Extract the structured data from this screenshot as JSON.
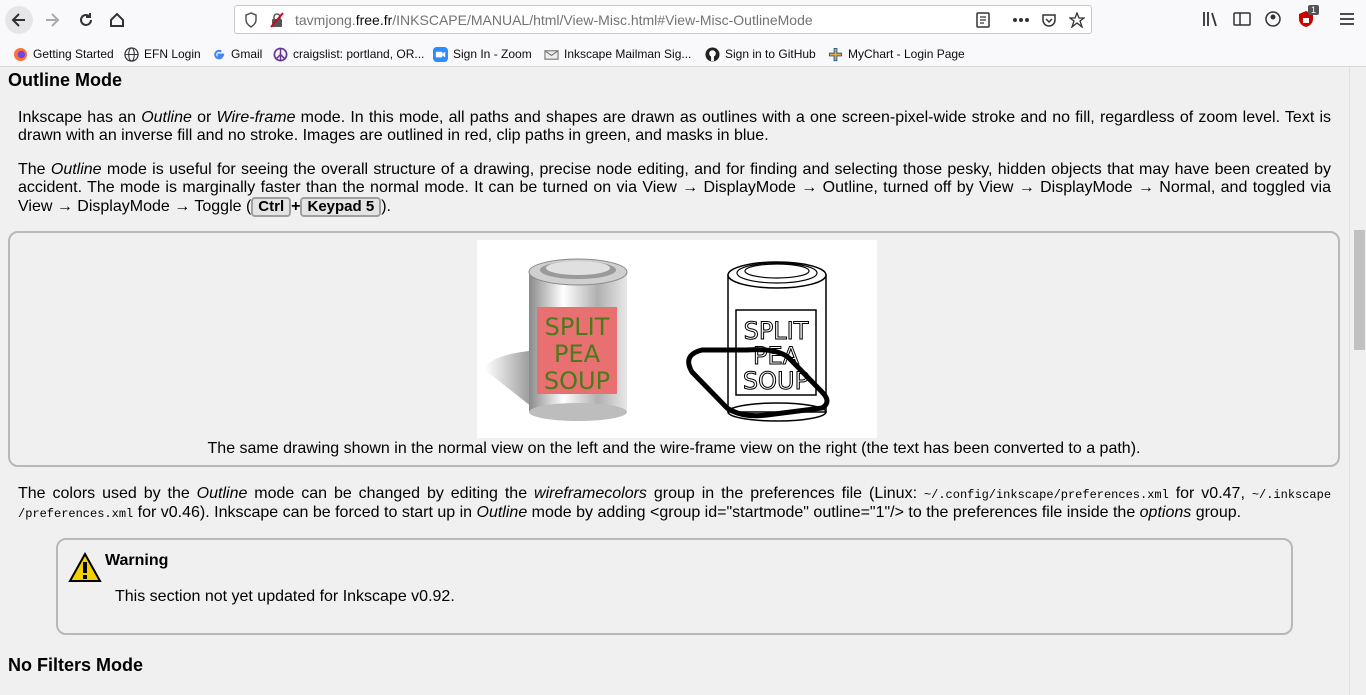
{
  "browser": {
    "url_prefix": "tavmjong.",
    "url_host": "free.fr",
    "url_path": "/INKSCAPE/MANUAL/html/View-Misc.html#View-Misc-OutlineMode",
    "notification_count": "1"
  },
  "bookmarks": [
    {
      "label": "Getting Started",
      "icon": "firefox-icon"
    },
    {
      "label": "EFN Login",
      "icon": "globe-icon"
    },
    {
      "label": "Gmail",
      "icon": "google-icon"
    },
    {
      "label": "craigslist: portland, OR...",
      "icon": "peace-icon"
    },
    {
      "label": "Sign In - Zoom",
      "icon": "zoom-icon"
    },
    {
      "label": "Inkscape Mailman Sig...",
      "icon": "mailman-icon"
    },
    {
      "label": "Sign in to GitHub",
      "icon": "github-icon"
    },
    {
      "label": "MyChart - Login Page",
      "icon": "cross-icon"
    }
  ],
  "page": {
    "heading1": "Outline Mode",
    "p1": {
      "a": "Inkscape has an ",
      "outline": "Outline",
      "b": " or ",
      "wireframe": "Wire-frame",
      "c": " mode. In this mode, all paths and shapes are drawn as outlines with a one screen-pixel-wide stroke and no fill, regardless of zoom level. Text is drawn with an inverse fill and no stroke. Images are outlined in red, clip paths in green, and masks in blue."
    },
    "p2": {
      "a": "The ",
      "outline": "Outline",
      "b": " mode is useful for seeing the overall structure of a drawing, precise node editing, and for finding and selecting those pesky, hidden objects that may have been created by accident. The mode is marginally faster than the normal mode. It can be turned on via View → DisplayMode → Outline, turned off by View → DisplayMode → Normal, and toggled via View → DisplayMode → Toggle (",
      "key1": "Ctrl",
      "plus": "+",
      "key2": "Keypad 5",
      "c": ")."
    },
    "figure": {
      "label_left": [
        "SPLIT",
        "PEA",
        "SOUP"
      ],
      "label_right": [
        "SPLIT",
        "PEA",
        "SOUP"
      ],
      "caption": "The same drawing shown in the normal view on the left and the wire-frame view on the right (the text has been converted to a path)."
    },
    "p3": {
      "a": "The colors used by the ",
      "outline": "Outline",
      "b": " mode can be changed by editing the ",
      "wireframe": "wireframecolors",
      "c": " group in the preferences file (Linux: ",
      "path1": "~/.config/inkscape/preferences.xml",
      "d": " for v0.47, ",
      "path2": "~/.inkscape /preferences.xml",
      "e": " for v0.46). Inkscape can be forced to start up in ",
      "outline2": "Outline",
      "f": " mode by adding <group id=\"startmode\" outline=\"1\"/> to the preferences file inside the ",
      "options": "options",
      "g": " group."
    },
    "warning": {
      "title": "Warning",
      "text": "This section not yet updated for Inkscape v0.92."
    },
    "heading2": "No Filters Mode"
  },
  "colors": {
    "can_label": "#e87070",
    "label_text": "#4a7a1a",
    "warning_yellow": "#f5d000"
  }
}
